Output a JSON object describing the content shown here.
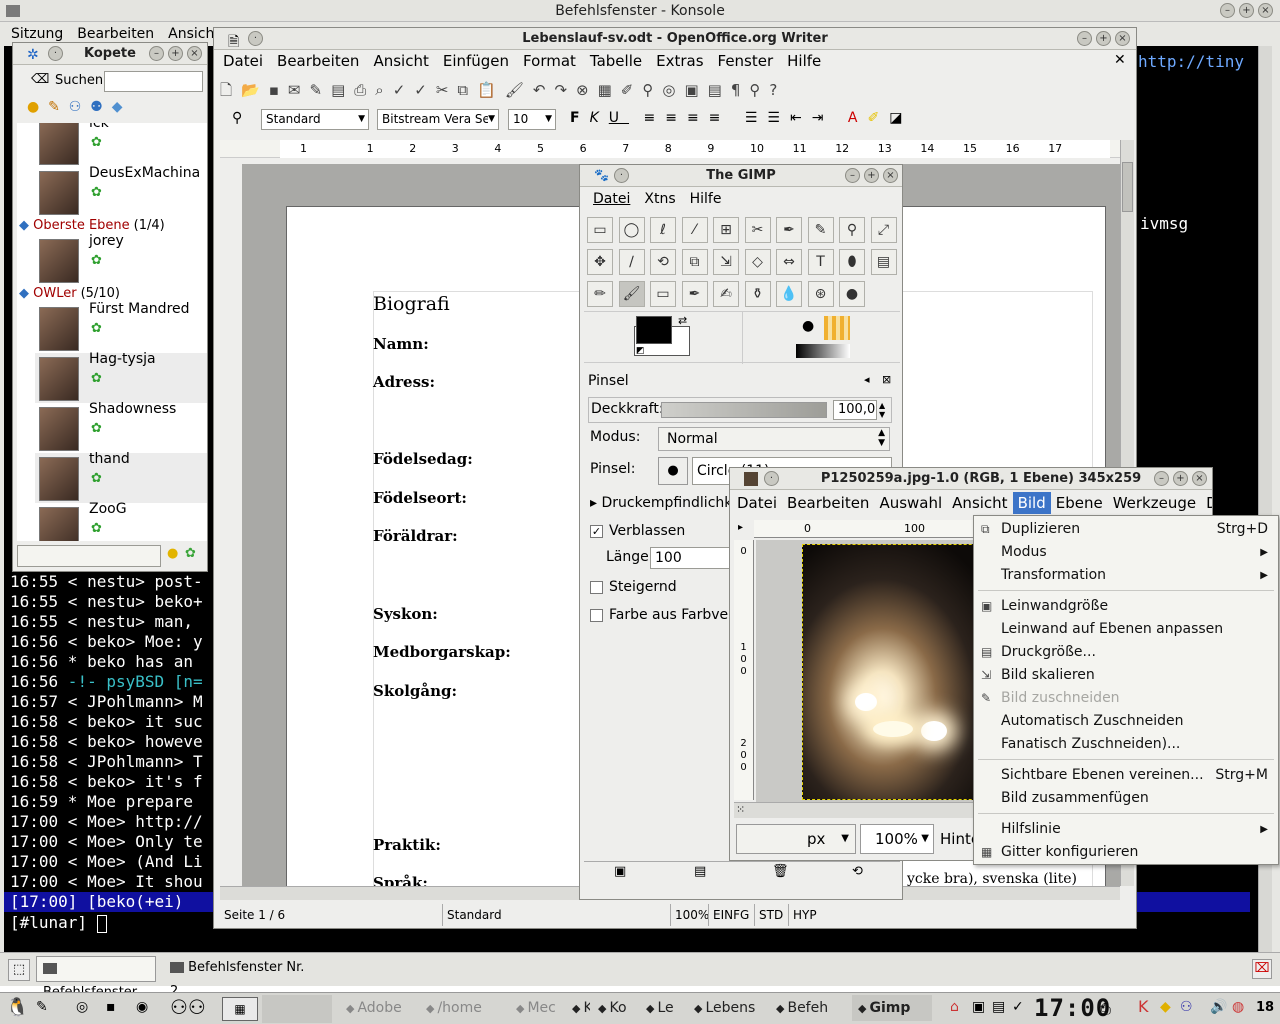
{
  "konsole": {
    "title": "Befehlsfenster - Konsole",
    "menu": [
      "Sitzung",
      "Bearbeiten",
      "Ansicht"
    ],
    "url_fragment": "http://tiny",
    "side_text": "ivmsg",
    "chat": [
      {
        "time": "16:55",
        "text": " < nestu> post-"
      },
      {
        "time": "16:55",
        "text": " < nestu> beko+"
      },
      {
        "time": "16:55",
        "text": " < nestu> man,"
      },
      {
        "time": "16:56",
        "text": " < beko> Moe: y"
      },
      {
        "time": "16:56",
        "text": "  * beko has an"
      },
      {
        "time": "16:56",
        "text": " -!- psyBSD [n="
      },
      {
        "time": "16:57",
        "text": " < JPohlmann> M"
      },
      {
        "time": "16:58",
        "text": " < beko> it suc"
      },
      {
        "time": "16:58",
        "text": " < beko> howeve"
      },
      {
        "time": "16:58",
        "text": " < JPohlmann> T"
      },
      {
        "time": "16:58",
        "text": " < beko> it's f"
      },
      {
        "time": "16:59",
        "text": "  * Moe prepare"
      },
      {
        "time": "17:00",
        "text": " < Moe> http://"
      },
      {
        "time": "17:00",
        "text": " < Moe> Only te"
      },
      {
        "time": "17:00",
        "text": " < Moe> (And Li"
      },
      {
        "time": "17:00",
        "text": " < Moe> It shou"
      }
    ],
    "status": " [17:00] [beko(+ei)",
    "prompt": "[#lunar] ",
    "tabs": [
      "Befehlsfenster",
      "Befehlsfenster Nr. 2"
    ]
  },
  "kopete": {
    "title": "Kopete",
    "search_label": "Suchen:",
    "search_value": "",
    "contacts": [
      {
        "name": "ick"
      },
      {
        "name": "DeusExMachina"
      }
    ],
    "group1": {
      "name": "Oberste Ebene",
      "count": "(1/4)"
    },
    "contacts2": [
      {
        "name": "jorey"
      }
    ],
    "group2": {
      "name": "OWLer",
      "count": "(5/10)"
    },
    "contacts3": [
      {
        "name": "Fürst Mandred"
      },
      {
        "name": "Hag-tysja"
      },
      {
        "name": "Shadowness"
      },
      {
        "name": "thand"
      },
      {
        "name": "ZooG"
      }
    ]
  },
  "writer": {
    "title": "Lebenslauf-sv.odt - OpenOffice.org Writer",
    "menu": [
      "Datei",
      "Bearbeiten",
      "Ansicht",
      "Einfügen",
      "Format",
      "Tabelle",
      "Extras",
      "Fenster",
      "Hilfe"
    ],
    "style": "Standard",
    "font": "Bitstream Vera Se",
    "size": "10",
    "ruler": [
      "1",
      "1",
      "2",
      "3",
      "4",
      "5",
      "6",
      "7",
      "8",
      "9",
      "10",
      "11",
      "12",
      "13",
      "14",
      "15",
      "16",
      "17"
    ],
    "heading": "Biografi",
    "fields": [
      "Namn:",
      "Adress:",
      "Födelsedag:",
      "Födelseort:",
      "Föräldrar:",
      "Syskon:",
      "Medborgarskap:",
      "Skolgång:",
      "Praktik:",
      "Språk:"
    ],
    "lang_text": "ycke bra), svenska (lite)",
    "status": {
      "page": "Seite 1 / 6",
      "style": "Standard",
      "zoom": "100%",
      "mode": "EINFG",
      "sel": "STD",
      "hyp": "HYP"
    }
  },
  "gimp": {
    "title": "The GIMP",
    "menu": [
      "Datei",
      "Xtns",
      "Hilfe"
    ],
    "tools": [
      "▭",
      "◯",
      "ℓ",
      "⁄",
      "⊞",
      "✂",
      "✒",
      "✎",
      "⚲",
      "⤢",
      "✥",
      "∕",
      "⟲",
      "⧉",
      "⇲",
      "◇",
      "⇔",
      "T",
      "⬮",
      "▤",
      "✏",
      "🖌",
      "▭",
      "✒",
      "✍",
      "⚱",
      "💧",
      "⊛",
      "●"
    ],
    "options_title": "Pinsel",
    "opacity_label": "Deckkraft:",
    "opacity_value": "100,0",
    "opacity_fraction": 1.0,
    "mode_label": "Modus:",
    "mode_value": "Normal",
    "brush_label": "Pinsel:",
    "brush_value": "Circle (11)",
    "pressure": "Druckempfindlichk",
    "fade": "Verblassen",
    "length_label": "Länge:",
    "length_value": "100",
    "incremental": "Steigernd",
    "color_grad": "Farbe aus Farbve"
  },
  "image": {
    "title": "P1250259a.jpg-1.0 (RGB, 1 Ebene) 345x259",
    "menu": [
      "Datei",
      "Bearbeiten",
      "Auswahl",
      "Ansicht",
      "Bild",
      "Ebene",
      "Werkzeuge",
      "Dia"
    ],
    "ruler_h": [
      "0",
      "100"
    ],
    "ruler_v": [
      "0",
      "1",
      "0",
      "0",
      "2",
      "0",
      "0"
    ],
    "unit": "px",
    "zoom": "100%",
    "status": "Hinter"
  },
  "bildmenu": [
    {
      "label": "Duplizieren",
      "accel": "Strg+D",
      "icon": "⧉",
      "sep_after": false,
      "disabled": false,
      "sub": false
    },
    {
      "label": "Modus",
      "accel": "",
      "icon": "",
      "sep_after": false,
      "disabled": false,
      "sub": true
    },
    {
      "label": "Transformation",
      "accel": "",
      "icon": "",
      "sep_after": true,
      "disabled": false,
      "sub": true
    },
    {
      "label": "Leinwandgröße",
      "accel": "",
      "icon": "▣",
      "sep_after": false,
      "disabled": false,
      "sub": false
    },
    {
      "label": "Leinwand auf Ebenen anpassen",
      "accel": "",
      "icon": "",
      "sep_after": false,
      "disabled": false,
      "sub": false
    },
    {
      "label": "Druckgröße...",
      "accel": "",
      "icon": "▤",
      "sep_after": false,
      "disabled": false,
      "sub": false
    },
    {
      "label": "Bild skalieren",
      "accel": "",
      "icon": "⇲",
      "sep_after": false,
      "disabled": false,
      "sub": false
    },
    {
      "label": "Bild zuschneiden",
      "accel": "",
      "icon": "✎",
      "sep_after": false,
      "disabled": true,
      "sub": false
    },
    {
      "label": "Automatisch Zuschneiden",
      "accel": "",
      "icon": "",
      "sep_after": false,
      "disabled": false,
      "sub": false
    },
    {
      "label": "Fanatisch Zuschneiden)...",
      "accel": "",
      "icon": "",
      "sep_after": true,
      "disabled": false,
      "sub": false
    },
    {
      "label": "Sichtbare Ebenen vereinen...",
      "accel": "Strg+M",
      "icon": "",
      "sep_after": false,
      "disabled": false,
      "sub": false
    },
    {
      "label": "Bild zusammenfügen",
      "accel": "",
      "icon": "",
      "sep_after": true,
      "disabled": false,
      "sub": false
    },
    {
      "label": "Hilfslinie",
      "accel": "",
      "icon": "",
      "sep_after": false,
      "disabled": false,
      "sub": true
    },
    {
      "label": "Gitter konfigurieren",
      "accel": "",
      "icon": "▦",
      "sep_after": false,
      "disabled": false,
      "sub": false
    }
  ],
  "taskbar": {
    "items": [
      "Adobe",
      "/home",
      "Mec",
      "K",
      "Ko",
      "Le",
      "Lebens",
      "Befeh",
      "Gimp"
    ],
    "clock": "17:00",
    "desktop": "18"
  }
}
